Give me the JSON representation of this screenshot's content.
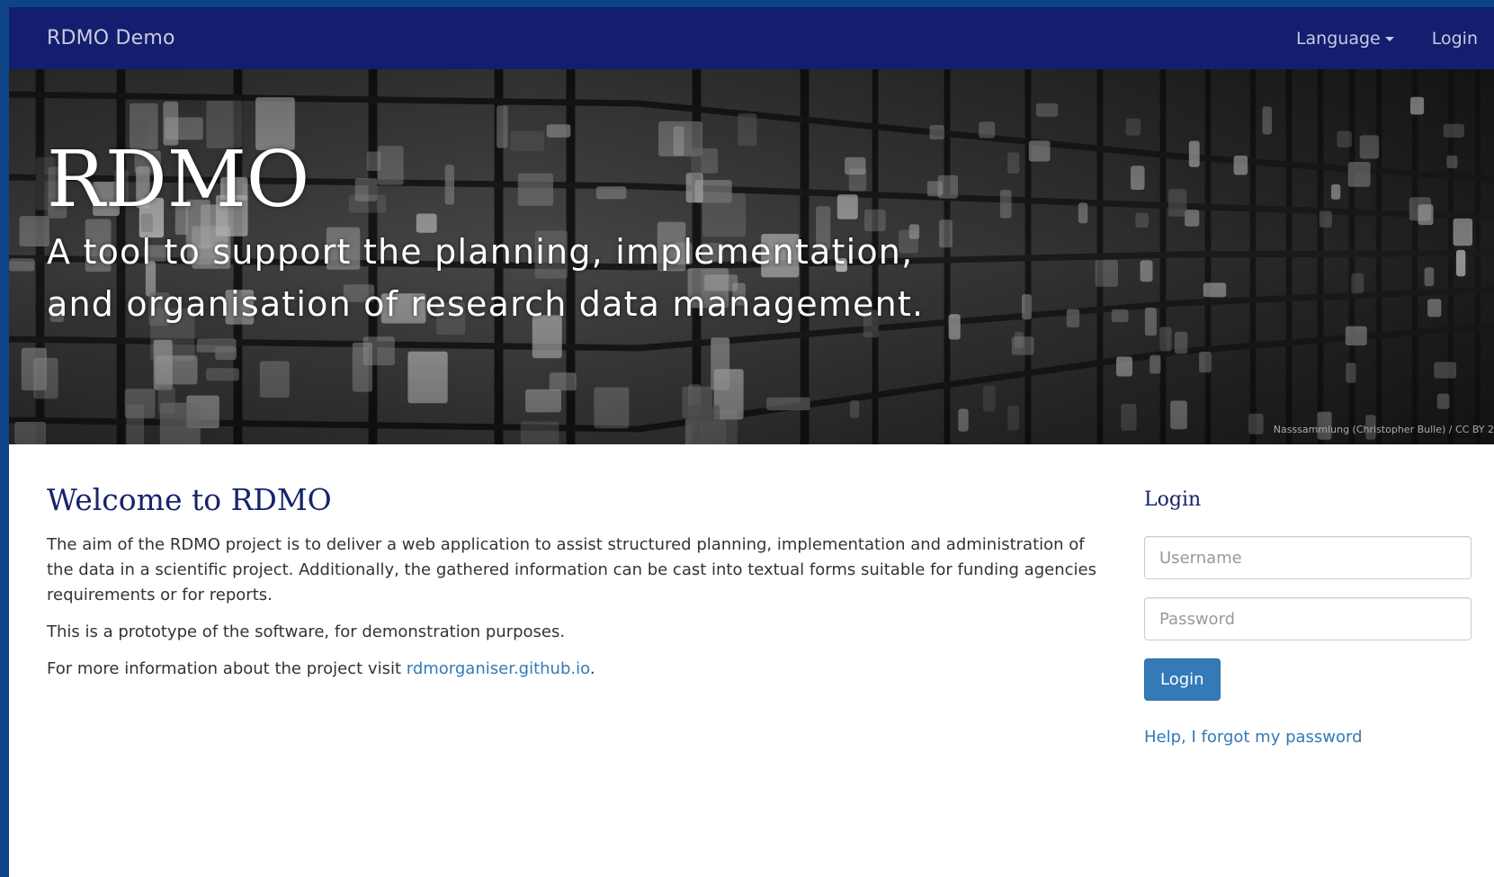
{
  "colors": {
    "navbar_bg": "#131e6e",
    "heading": "#16236d",
    "link": "#337ab7",
    "button_bg": "#337ab7",
    "page_border": "#0d4487"
  },
  "navbar": {
    "brand": "RDMO Demo",
    "language_label": "Language",
    "login_label": "Login"
  },
  "hero": {
    "title": "RDMO",
    "tagline": "A tool to support the planning, implementation, and organisation of research data management.",
    "credit": "Nasssammlung (Christopher Bulle) / CC BY 2"
  },
  "main": {
    "welcome_title": "Welcome to RDMO",
    "paragraph1": "The aim of the RDMO project is to deliver a web application to assist structured planning, implementation and administration of the data in a scientific project. Additionally, the gathered information can be cast into textual forms suitable for funding agencies requirements or for reports.",
    "paragraph2": "This is a prototype of the software, for demonstration purposes.",
    "paragraph3_prefix": "For more information about the project visit ",
    "paragraph3_link": "rdmorganiser.github.io",
    "paragraph3_suffix": "."
  },
  "login": {
    "title": "Login",
    "username_placeholder": "Username",
    "password_placeholder": "Password",
    "button_label": "Login",
    "forgot_label": "Help, I forgot my password"
  },
  "icons": {
    "language_caret": "caret-down-icon"
  }
}
